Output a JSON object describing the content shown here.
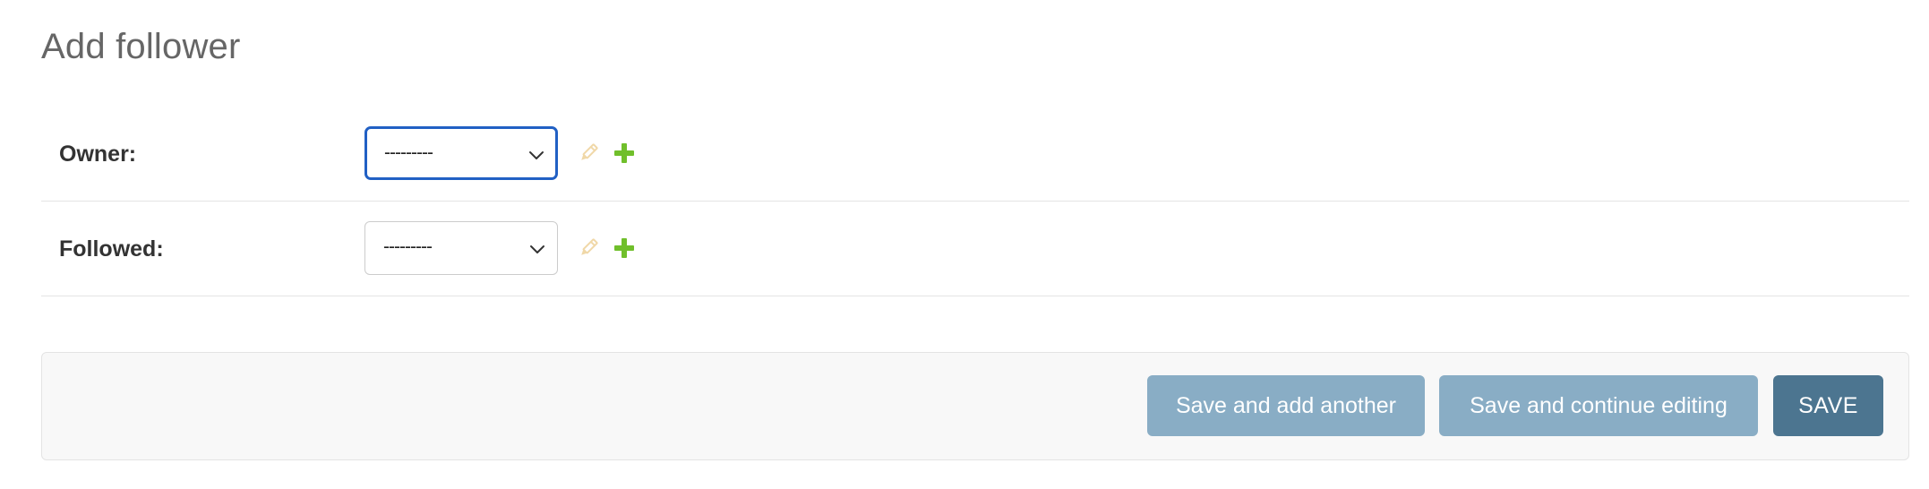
{
  "page": {
    "title": "Add follower"
  },
  "fields": [
    {
      "label": "Owner:",
      "selected_value": "---------",
      "focused": true
    },
    {
      "label": "Followed:",
      "selected_value": "---------",
      "focused": false
    }
  ],
  "icons": {
    "change": "pencil-icon",
    "add": "plus-icon"
  },
  "submit_row": {
    "save_add_another_label": "Save and add another",
    "save_continue_label": "Save and continue editing",
    "save_label": "SAVE"
  },
  "colors": {
    "focus_border": "#2160c4",
    "secondary_button": "#89adc5",
    "primary_button": "#4c7590",
    "add_icon": "#70bf2b",
    "change_icon": "#f0d8a8",
    "title": "#666666"
  }
}
